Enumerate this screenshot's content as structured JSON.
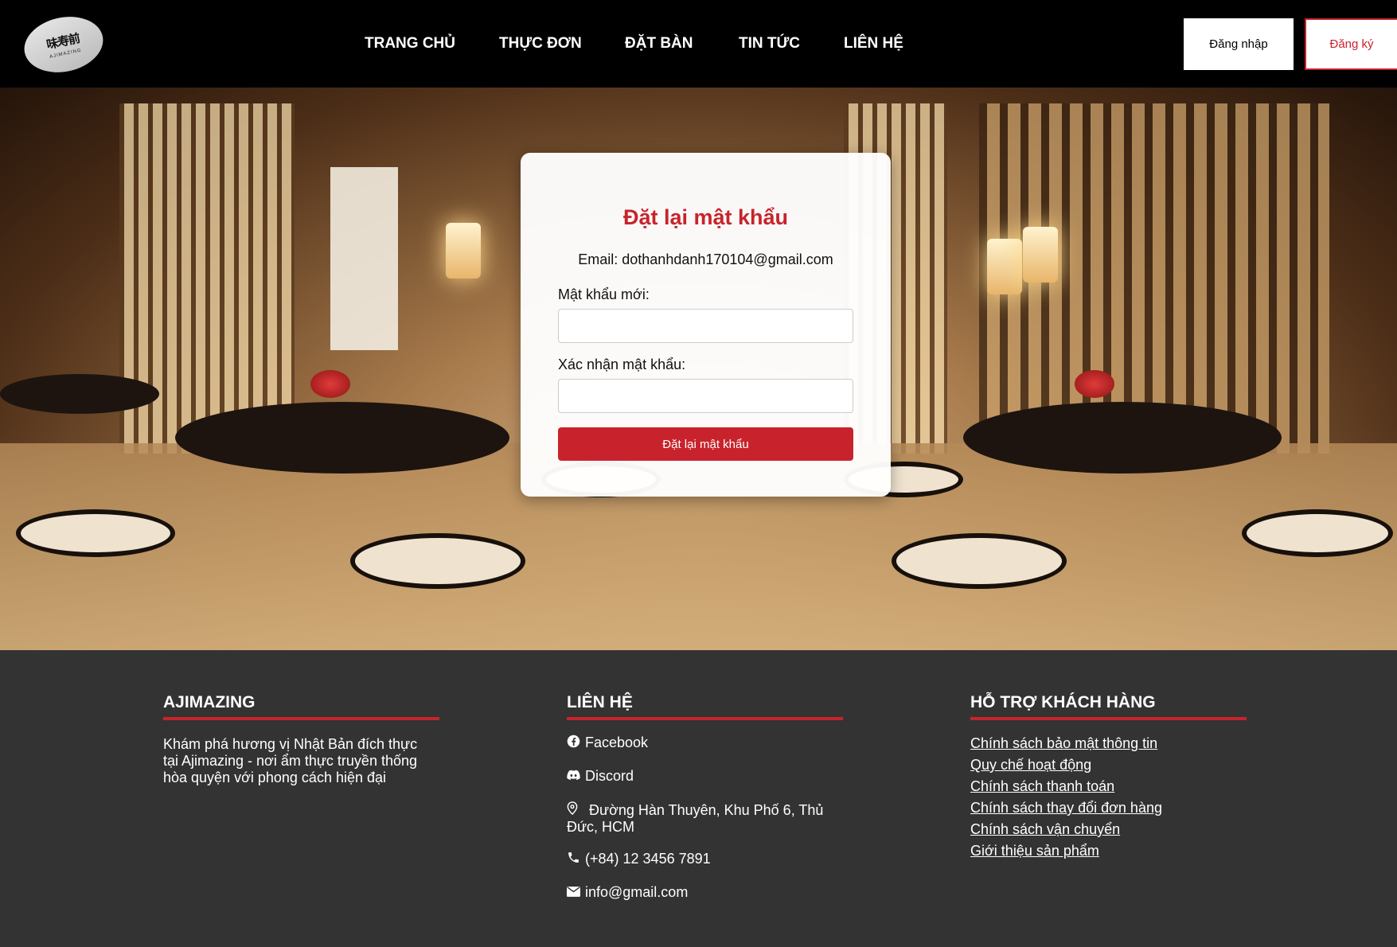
{
  "header": {
    "logo_text": "味寿前",
    "logo_sub": "AJIMAZING",
    "nav": [
      "TRANG CHỦ",
      "THỰC ĐƠN",
      "ĐẶT BÀN",
      "TIN TỨC",
      "LIÊN HỆ"
    ],
    "login_label": "Đăng nhập",
    "register_label": "Đăng ký"
  },
  "card": {
    "title": "Đặt lại mật khẩu",
    "email_text": "Email: dothanhdanh170104@gmail.com",
    "new_password_label": "Mật khẩu mới:",
    "new_password_value": "",
    "confirm_password_label": "Xác nhận mật khẩu:",
    "confirm_password_value": "",
    "submit_label": "Đặt lại mật khẩu"
  },
  "footer": {
    "brand_title": "AJIMAZING",
    "brand_text": "Khám phá hương vị Nhật Bản đích thực tại Ajimazing - nơi ẩm thực truyền thống hòa quyện với phong cách hiện đại",
    "contact_title": "LIÊN HỆ",
    "contact": {
      "facebook": "Facebook",
      "discord": "Discord",
      "address": "Đường Hàn Thuyên, Khu Phố 6, Thủ Đức, HCM",
      "phone": "(+84) 12 3456 7891",
      "email": "info@gmail.com"
    },
    "support_title": "HỖ TRỢ KHÁCH HÀNG",
    "support_links": [
      "Chính sách bảo mật thông tin",
      "Quy chế hoạt động",
      "Chính sách thanh toán",
      "Chính sách thay đổi đơn hàng",
      "Chính sách vận chuyển",
      "Giới thiệu sản phẩm"
    ]
  },
  "colors": {
    "accent": "#c8232c",
    "header_bg": "#000000",
    "footer_bg": "#333333"
  }
}
